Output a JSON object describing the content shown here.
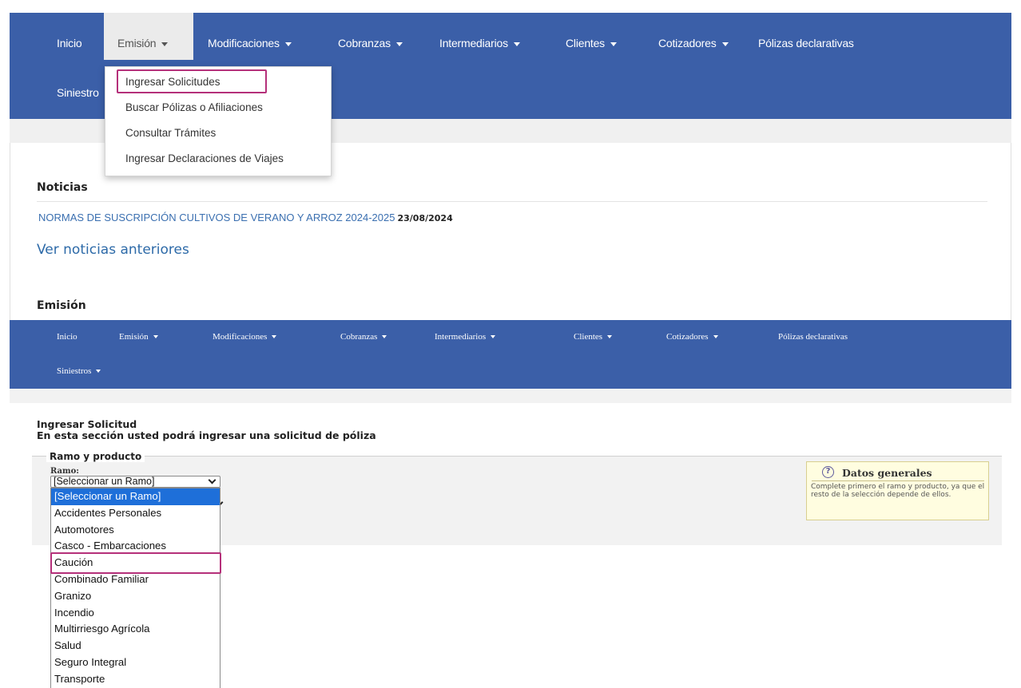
{
  "nav": {
    "items": [
      {
        "label": "Inicio",
        "caret": false
      },
      {
        "label": "Emisión",
        "caret": true
      },
      {
        "label": "Modificaciones",
        "caret": true
      },
      {
        "label": "Cobranzas",
        "caret": true
      },
      {
        "label": "Intermediarios",
        "caret": true
      },
      {
        "label": "Clientes",
        "caret": true
      },
      {
        "label": "Cotizadores",
        "caret": true
      },
      {
        "label": "Pólizas declarativas",
        "caret": false
      }
    ],
    "siniestros": "Siniestro"
  },
  "emision_menu": {
    "items": [
      "Ingresar Solicitudes",
      "Buscar Pólizas o Afiliaciones",
      "Consultar Trámites",
      "Ingresar Declaraciones de Viajes"
    ]
  },
  "news": {
    "heading": "Noticias",
    "link_text": "NORMAS DE SUSCRIPCIÓN CULTIVOS DE VERANO Y ARROZ 2024-2025",
    "date": "23/08/2024",
    "more": "Ver noticias anteriores"
  },
  "emision_heading": "Emisión",
  "nav2": {
    "items": [
      {
        "label": "Inicio",
        "caret": false
      },
      {
        "label": "Emisión",
        "caret": true
      },
      {
        "label": "Modificaciones",
        "caret": true
      },
      {
        "label": "Cobranzas",
        "caret": true
      },
      {
        "label": "Intermediarios",
        "caret": true
      },
      {
        "label": "Clientes",
        "caret": true
      },
      {
        "label": "Cotizadores",
        "caret": true
      },
      {
        "label": "Pólizas declarativas",
        "caret": false
      }
    ],
    "siniestros": "Siniestros"
  },
  "form": {
    "title": "Ingresar Solicitud",
    "subtitle": "En esta sección usted podrá ingresar una solicitud de póliza",
    "legend": "Ramo y producto",
    "ramo_label": "Ramo:",
    "ramo_value": "[Seleccionar un Ramo]",
    "options": [
      "[Seleccionar un Ramo]",
      "Accidentes Personales",
      "Automotores",
      "Casco - Embarcaciones",
      "Caución",
      "Combinado Familiar",
      "Granizo",
      "Incendio",
      "Multirriesgo Agrícola",
      "Salud",
      "Seguro Integral",
      "Transporte"
    ],
    "selected_index": 0,
    "highlighted_option": "Caución"
  },
  "help": {
    "title": "Datos generales",
    "text": "Complete primero el ramo y producto, ya que el resto de la selección depende de ellos."
  },
  "colors": {
    "nav_blue": "#3b5fa8",
    "highlight_magenta": "#b5307a",
    "selected_blue": "#1e6fd9",
    "link_blue": "#3a6fb0"
  }
}
